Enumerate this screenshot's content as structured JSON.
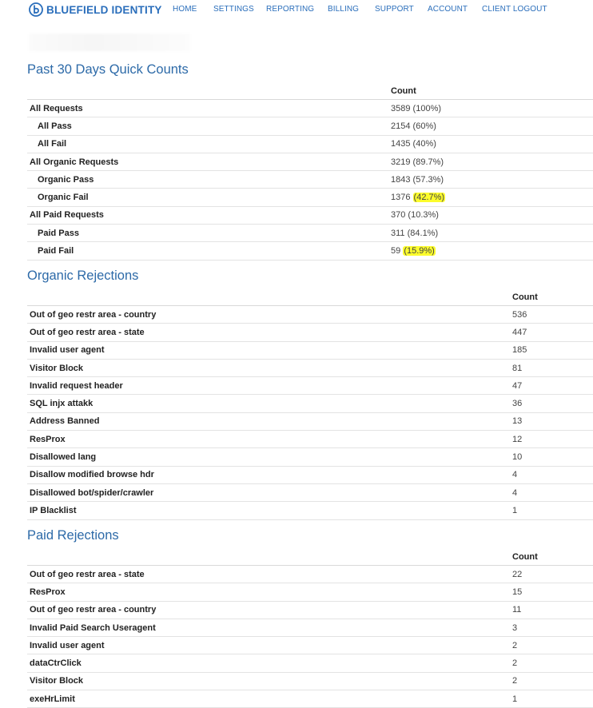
{
  "brand": {
    "name": "BLUEFIELD IDENTITY",
    "logo_icon": "bluefield-logo-icon",
    "color": "#2a6ebb"
  },
  "nav": [
    "HOME",
    "SETTINGS",
    "REPORTING",
    "BILLING",
    "SUPPORT",
    "ACCOUNT",
    "CLIENT LOGOUT"
  ],
  "quick_counts": {
    "title": "Past 30 Days Quick Counts",
    "count_header": "Count",
    "rows": [
      {
        "label": "All Requests",
        "count": "3589",
        "pct": "(100%)",
        "indent": false,
        "highlight": false
      },
      {
        "label": "All Pass",
        "count": "2154",
        "pct": "(60%)",
        "indent": true,
        "highlight": false
      },
      {
        "label": "All Fail",
        "count": "1435",
        "pct": "(40%)",
        "indent": true,
        "highlight": false
      },
      {
        "label": "All Organic Requests",
        "count": "3219",
        "pct": "(89.7%)",
        "indent": false,
        "highlight": false
      },
      {
        "label": "Organic Pass",
        "count": "1843",
        "pct": "(57.3%)",
        "indent": true,
        "highlight": false
      },
      {
        "label": "Organic Fail",
        "count": "1376",
        "pct": "(42.7%)",
        "indent": true,
        "highlight": true
      },
      {
        "label": "All Paid Requests",
        "count": "370",
        "pct": "(10.3%)",
        "indent": false,
        "highlight": false
      },
      {
        "label": "Paid Pass",
        "count": "311",
        "pct": "(84.1%)",
        "indent": true,
        "highlight": false
      },
      {
        "label": "Paid Fail",
        "count": "59",
        "pct": "(15.9%)",
        "indent": true,
        "highlight": true
      }
    ]
  },
  "organic_rejections": {
    "title": "Organic Rejections",
    "count_header": "Count",
    "rows": [
      {
        "label": "Out of geo restr area - country",
        "count": "536"
      },
      {
        "label": "Out of geo restr area - state",
        "count": "447"
      },
      {
        "label": "Invalid user agent",
        "count": "185"
      },
      {
        "label": "Visitor Block",
        "count": "81"
      },
      {
        "label": "Invalid request header",
        "count": "47"
      },
      {
        "label": "SQL injx attakk",
        "count": "36"
      },
      {
        "label": "Address Banned",
        "count": "13"
      },
      {
        "label": "ResProx",
        "count": "12"
      },
      {
        "label": "Disallowed lang",
        "count": "10"
      },
      {
        "label": "Disallow modified browse hdr",
        "count": "4"
      },
      {
        "label": "Disallowed bot/spider/crawler",
        "count": "4"
      },
      {
        "label": "IP Blacklist",
        "count": "1"
      }
    ]
  },
  "paid_rejections": {
    "title": "Paid Rejections",
    "count_header": "Count",
    "rows": [
      {
        "label": "Out of geo restr area - state",
        "count": "22"
      },
      {
        "label": "ResProx",
        "count": "15"
      },
      {
        "label": "Out of geo restr area - country",
        "count": "11"
      },
      {
        "label": "Invalid Paid Search Useragent",
        "count": "3"
      },
      {
        "label": "Invalid user agent",
        "count": "2"
      },
      {
        "label": "dataCtrClick",
        "count": "2"
      },
      {
        "label": "Visitor Block",
        "count": "2"
      },
      {
        "label": "exeHrLimit",
        "count": "1"
      }
    ]
  },
  "colors": {
    "title": "#2d6aa8",
    "highlight": "#fcfc2c"
  }
}
